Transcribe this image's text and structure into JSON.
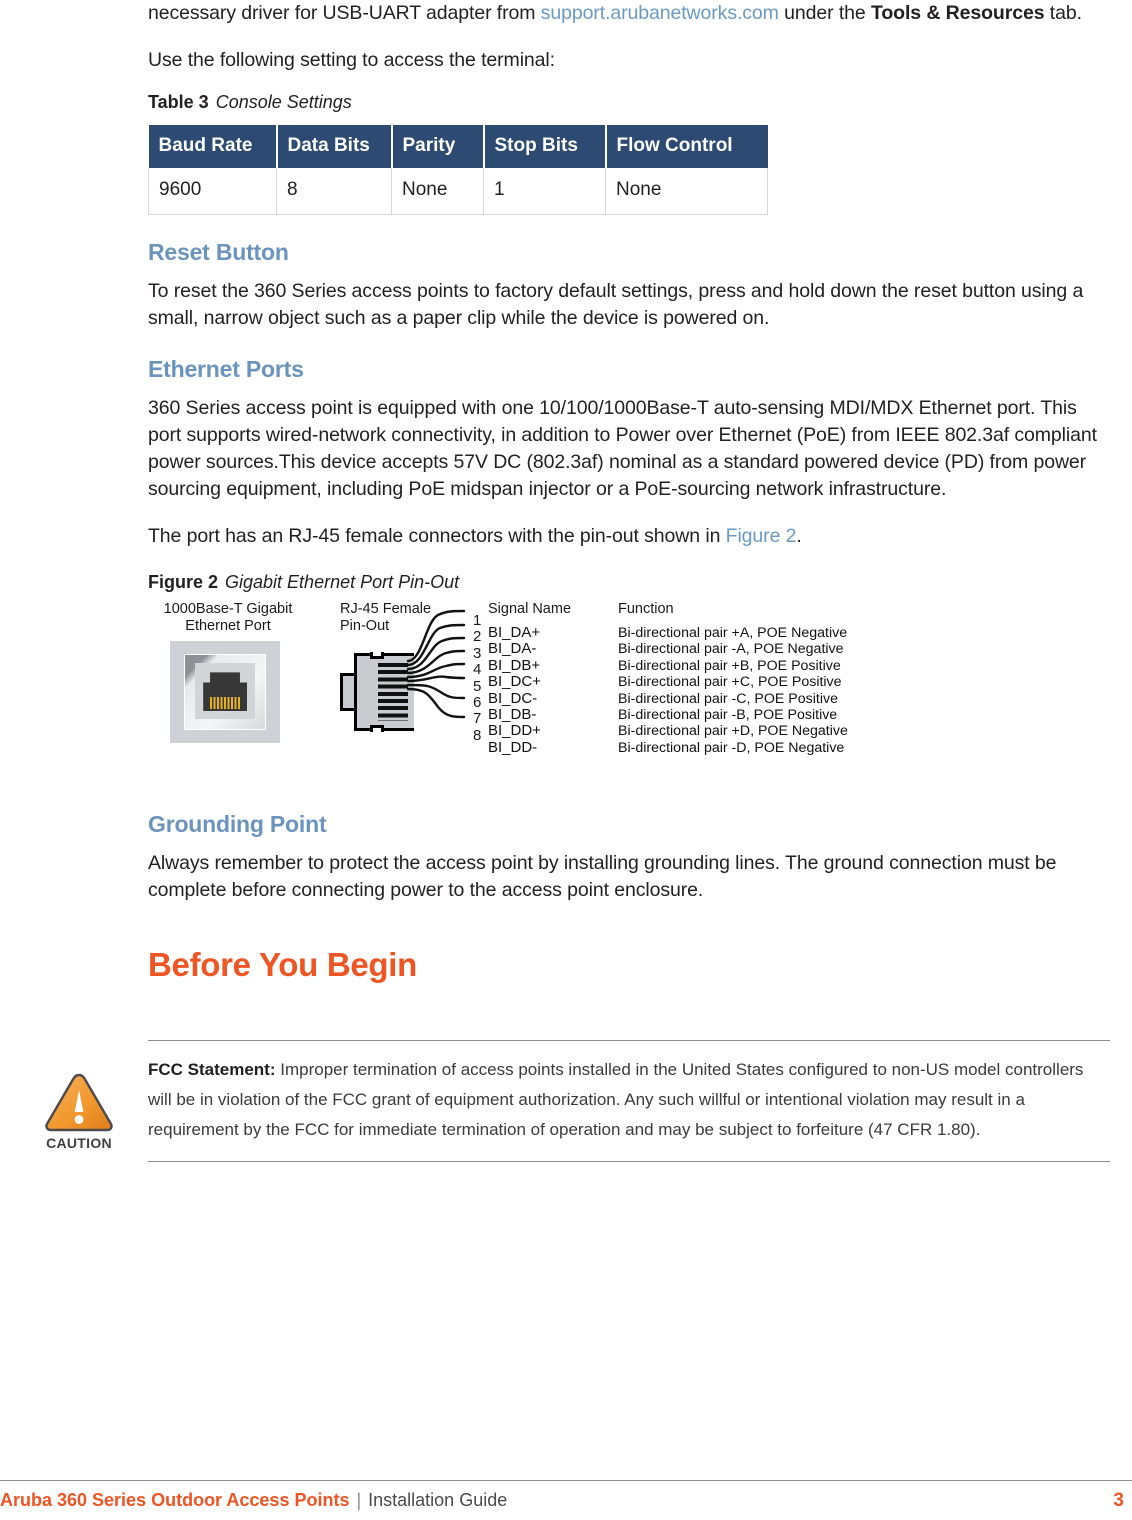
{
  "intro": {
    "para1_pre": "necessary driver for USB-UART adapter from ",
    "para1_link": "support.arubanetworks.com",
    "para1_mid": " under the ",
    "para1_bold": "Tools & Resources",
    "para1_post": " tab.",
    "para2": "Use the following setting to access the terminal:"
  },
  "table3": {
    "label": "Table 3",
    "title": "Console Settings",
    "headers": [
      "Baud Rate",
      "Data Bits",
      "Parity",
      "Stop Bits",
      "Flow Control"
    ],
    "rows": [
      [
        "9600",
        "8",
        "None",
        "1",
        "None"
      ]
    ],
    "header_bg": "#2d4a72",
    "header_fg": "#ffffff"
  },
  "sections": {
    "reset_button": {
      "heading": "Reset Button",
      "body": "To reset the 360 Series access points to factory default settings, press and hold down the reset button using a small, narrow object such as a paper clip while the device is powered on."
    },
    "ethernet_ports": {
      "heading": "Ethernet Ports",
      "body": "360 Series access point is equipped with one 10/100/1000Base-T auto-sensing MDI/MDX Ethernet port. This port supports wired-network connectivity, in addition to Power over Ethernet (PoE) from IEEE 802.3af compliant power sources.This device accepts 57V DC (802.3af) nominal as a standard powered device (PD) from power sourcing equipment, including PoE midspan injector or a PoE-sourcing network infrastructure.",
      "body2_pre": "The port has an RJ-45 female connectors with the pin-out shown in ",
      "body2_link": "Figure 2",
      "body2_post": "."
    },
    "grounding_point": {
      "heading": "Grounding Point",
      "body": "Always remember to protect the access point by installing grounding lines. The ground connection must be complete before connecting power to the access point enclosure."
    },
    "before_you_begin": {
      "heading": "Before You Begin"
    }
  },
  "figure2": {
    "label": "Figure 2",
    "title": "Gigabit Ethernet Port Pin-Out",
    "port_label_line1": "1000Base-T Gigabit",
    "port_label_line2": "Ethernet Port",
    "rj45_label_line1": "RJ-45 Female",
    "rj45_label_line2": "Pin-Out",
    "col_signal_header": "Signal Name",
    "col_function_header": "Function",
    "pins": [
      "1",
      "2",
      "3",
      "4",
      "5",
      "6",
      "7",
      "8"
    ],
    "signal_names": [
      "BI_DA+",
      "BI_DA-",
      "BI_DB+",
      "BI_DC+",
      "BI_DC-",
      "BI_DB-",
      "BI_DD+",
      "BI_DD-"
    ],
    "functions": [
      "Bi-directional pair +A, POE Negative",
      "Bi-directional pair -A, POE Negative",
      "Bi-directional pair +B, POE Positive",
      "Bi-directional pair +C, POE Positive",
      "Bi-directional pair -C, POE Positive",
      "Bi-directional pair -B, POE Positive",
      "Bi-directional pair +D, POE Negative",
      "Bi-directional pair -D, POE Negative"
    ]
  },
  "caution": {
    "icon_word": "CAUTION",
    "bold_lead": "FCC Statement:",
    "text": " Improper termination of access points installed in the United States configured to non-US model controllers will be in violation of the FCC grant of equipment authorization. Any such willful or intentional violation may result in a requirement by the FCC for immediate termination of operation and may be subject to forfeiture (47 CFR 1.80).",
    "icon_color": "#f09a3e"
  },
  "footer": {
    "title": "Aruba 360 Series Outdoor Access Points",
    "separator": "|",
    "subtitle": "Installation Guide",
    "page_number": "3",
    "accent": "#ef5423"
  }
}
